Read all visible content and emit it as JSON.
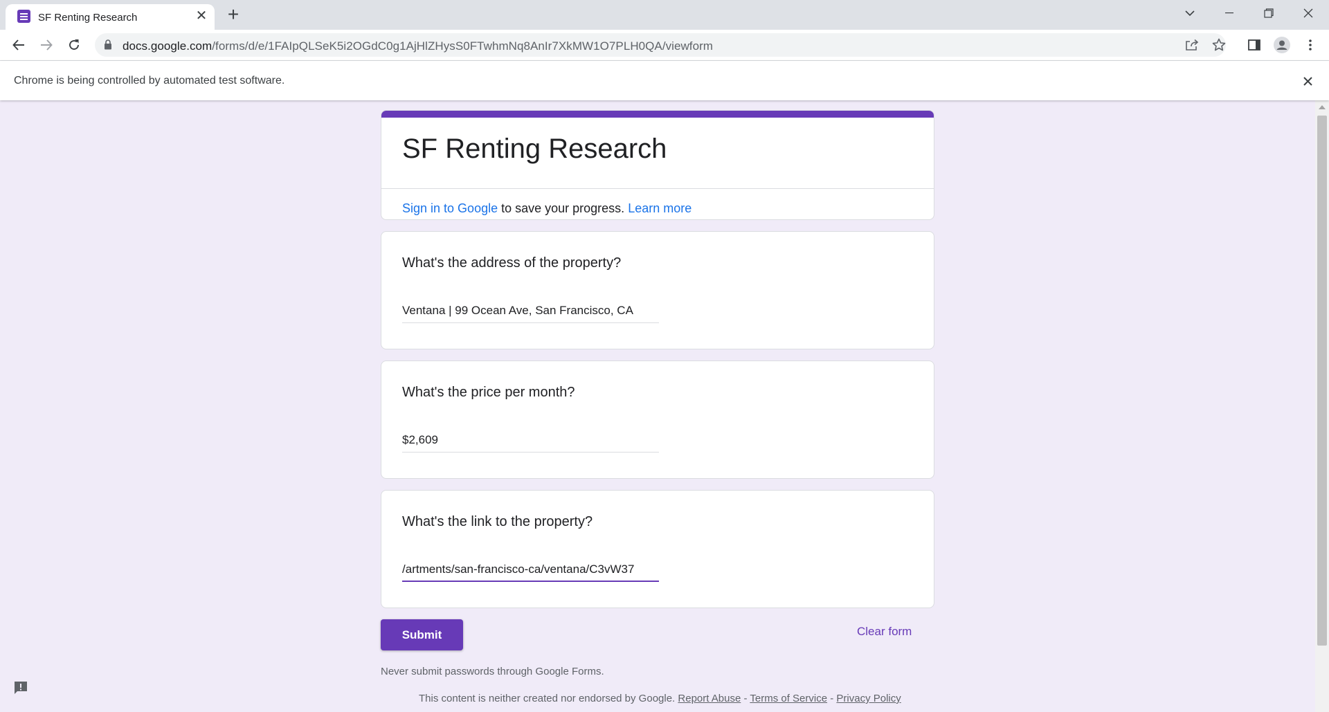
{
  "browser": {
    "tab_title": "SF Renting Research",
    "new_tab_symbol": "+",
    "url_host": "docs.google.com",
    "url_path": "/forms/d/e/1FAIpQLSeK5i2OGdC0g1AjHlZHysS0FTwhmNq8AnIr7XkMW1O7PLH0QA/viewform",
    "infobar_message": "Chrome is being controlled by automated test software.",
    "icons": [
      "form-favicon",
      "close-icon",
      "new-tab-icon",
      "tab-search-icon",
      "minimize-icon",
      "restore-icon",
      "back-icon",
      "forward-icon",
      "reload-icon",
      "lock-icon",
      "share-icon",
      "star-icon",
      "side-panel-icon",
      "profile-icon",
      "more-icon"
    ]
  },
  "form": {
    "title": "SF Renting Research",
    "signin_link": "Sign in to Google",
    "signin_middle": " to save your progress. ",
    "learn_more": "Learn more",
    "questions": [
      {
        "label": "What's the address of the property?",
        "value": "Ventana | 99 Ocean Ave, San Francisco, CA"
      },
      {
        "label": "What's the price per month?",
        "value": "$2,609"
      },
      {
        "label": "What's the link to the property?",
        "value": "artments/san-francisco-ca/ventana/C3vW37/"
      }
    ],
    "submit_label": "Submit",
    "clear_label": "Clear form",
    "password_note": "Never submit passwords through Google Forms."
  },
  "footer": {
    "disclaimer": "This content is neither created nor endorsed by Google. ",
    "report_abuse": "Report Abuse",
    "sep1": " - ",
    "terms": "Terms of Service",
    "sep2": " - ",
    "privacy": "Privacy Policy"
  },
  "colors": {
    "accent": "#673ab7",
    "page_bg": "#f0ebf8",
    "link": "#1a73e8"
  }
}
